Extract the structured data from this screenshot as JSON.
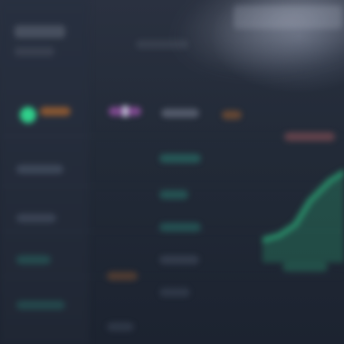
{
  "colors": {
    "bg": "#1f2633",
    "panel": "#283040",
    "accent_green": "#2fd08a",
    "accent_orange": "#d9782a",
    "accent_pink": "#c862d6",
    "accent_teal": "#2fbf9e",
    "accent_red": "#d06a6a"
  },
  "icons": {
    "status": "status-dot",
    "tag": "tag-icon"
  }
}
